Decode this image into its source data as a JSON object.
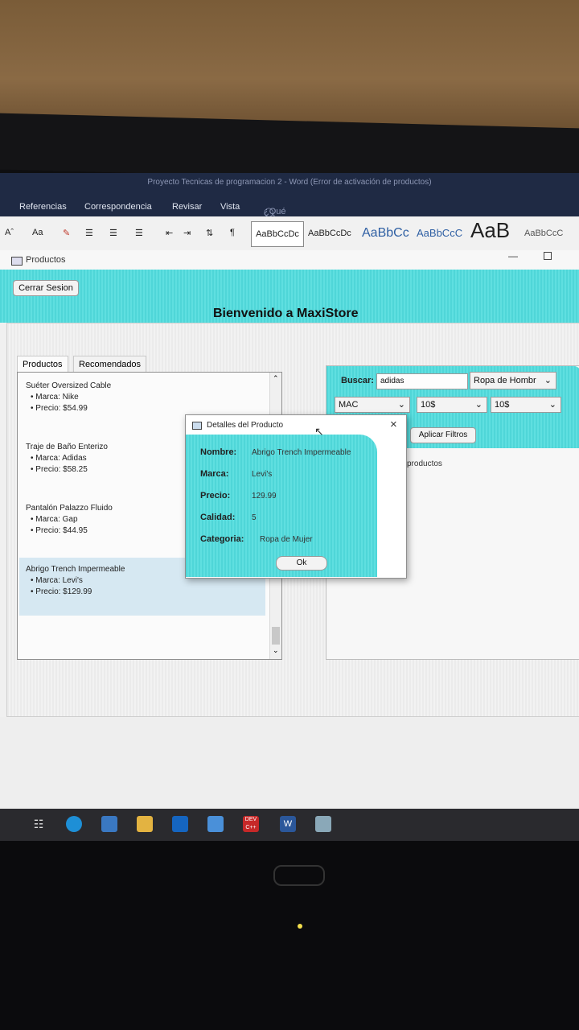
{
  "word": {
    "title": "Proyecto Tecnicas de programacion 2 - Word (Error de activación de productos)",
    "tabs": [
      "Referencias",
      "Correspondencia",
      "Revisar",
      "Vista"
    ],
    "tell_me": "¿Qué desea hacer?",
    "font_size_label": "Aa",
    "styles": [
      "AaBbCcDc",
      "AaBbCcDc",
      "AaBbCc",
      "AaBbCcC",
      "AaB",
      "AaBbCcC"
    ]
  },
  "app": {
    "window_title": "Productos",
    "logout_label": "Cerrar Sesion",
    "welcome": "Bienvenido a MaxiStore",
    "tabs": [
      "Productos",
      "Recomendados"
    ],
    "products": [
      {
        "name": "Suéter Oversized Cable",
        "brand": "• Marca: Nike",
        "price": "• Precio: $54.99"
      },
      {
        "name": "Traje de Baño Enterizo",
        "brand": "• Marca: Adidas",
        "price": "• Precio: $58.25"
      },
      {
        "name": "Pantalón Palazzo Fluido",
        "brand": "• Marca: Gap",
        "price": "• Precio: $44.95"
      },
      {
        "name": "Abrigo Trench Impermeable",
        "brand": "• Marca: Levi's",
        "price": "• Precio: $129.99"
      }
    ],
    "search_label": "Buscar:",
    "search_value": "adidas",
    "category_combo": "Ropa de Hombr",
    "brand_combo": "MAC",
    "price_min": "10$",
    "price_max": "10$",
    "apply_label": "Aplicar Filtros",
    "results_label": "productos"
  },
  "dialog": {
    "title": "Detalles del Producto",
    "fields": [
      {
        "label": "Nombre:",
        "value": "Abrigo Trench Impermeable"
      },
      {
        "label": "Marca:",
        "value": "Levi's"
      },
      {
        "label": "Precio:",
        "value": "129.99"
      },
      {
        "label": "Calidad:",
        "value": "5"
      },
      {
        "label": "Categoria:",
        "value": "Ropa de Mujer"
      }
    ],
    "ok_label": "Ok"
  },
  "taskbar": {
    "dev_label": "DEV C++",
    "word_label": "W"
  },
  "colors": {
    "accent": "#55dadb",
    "taskbar": "#2a2a2e",
    "word_bar": "#1f2a44"
  }
}
